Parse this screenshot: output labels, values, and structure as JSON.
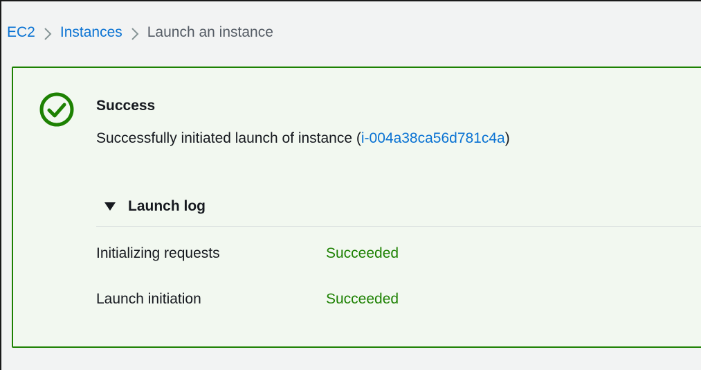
{
  "breadcrumb": {
    "items": [
      {
        "label": "EC2"
      },
      {
        "label": "Instances"
      },
      {
        "label": "Launch an instance"
      }
    ]
  },
  "alert": {
    "type": "success",
    "icon": "check-circle-icon",
    "title": "Success",
    "message_prefix": "Successfully initiated launch of instance (",
    "instance_id": "i-004a38ca56d781c4a",
    "message_suffix": ")",
    "colors": {
      "success": "#1d8102",
      "background": "#f2f8f0",
      "link": "#0972d3"
    }
  },
  "launch_log": {
    "toggle_label": "Launch log",
    "expanded": true,
    "rows": [
      {
        "name": "Initializing requests",
        "status": "Succeeded"
      },
      {
        "name": "Launch initiation",
        "status": "Succeeded"
      }
    ]
  }
}
